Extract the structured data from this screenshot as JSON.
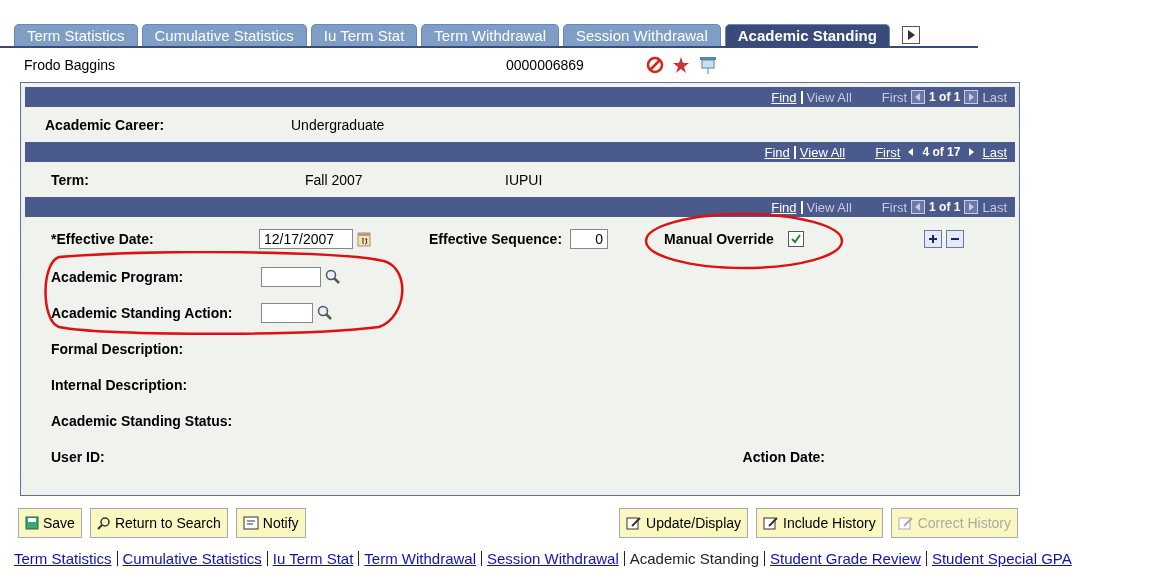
{
  "tabs": [
    {
      "label": "Term Statistics",
      "selected": false
    },
    {
      "label": "Cumulative Statistics",
      "selected": false
    },
    {
      "label": "Iu Term Stat",
      "selected": false
    },
    {
      "label": "Term Withdrawal",
      "selected": false
    },
    {
      "label": "Session Withdrawal",
      "selected": false
    },
    {
      "label": "Academic Standing",
      "selected": true
    }
  ],
  "header": {
    "name": "Frodo Baggins",
    "id": "0000006869"
  },
  "career_bar": {
    "find": {
      "label": "Find",
      "enabled": true
    },
    "view_all": {
      "label": "View All",
      "enabled": false
    },
    "first": {
      "label": "First",
      "enabled": false
    },
    "position": "1 of 1",
    "last": {
      "label": "Last",
      "enabled": false
    }
  },
  "career": {
    "label": "Academic Career:",
    "value": "Undergraduate"
  },
  "term_bar": {
    "find": {
      "label": "Find",
      "enabled": true
    },
    "view_all": {
      "label": "View All",
      "enabled": true
    },
    "first": {
      "label": "First",
      "enabled": true
    },
    "position": "4 of 17",
    "last": {
      "label": "Last",
      "enabled": true
    }
  },
  "term": {
    "label": "Term:",
    "value": "Fall 2007",
    "institution": "IUPUI"
  },
  "standing_bar": {
    "find": {
      "label": "Find",
      "enabled": true
    },
    "view_all": {
      "label": "View All",
      "enabled": false
    },
    "first": {
      "label": "First",
      "enabled": false
    },
    "position": "1 of 1",
    "last": {
      "label": "Last",
      "enabled": false
    }
  },
  "effective_date": {
    "label": "*Effective Date:",
    "value": "12/17/2007"
  },
  "effective_sequence": {
    "label": "Effective Sequence:",
    "value": "0"
  },
  "manual_override": {
    "label": "Manual Override",
    "checked": true
  },
  "academic_program": {
    "label": "Academic Program:"
  },
  "standing_action": {
    "label": "Academic Standing Action:"
  },
  "descriptions": [
    "Formal Description:",
    "Internal Description:",
    "Academic Standing Status:"
  ],
  "user_id": {
    "label": "User ID:"
  },
  "action_date": {
    "label": "Action Date:"
  },
  "buttons_left": [
    {
      "label": "Save",
      "kind": "save",
      "enabled": true
    },
    {
      "label": "Return to Search",
      "kind": "search",
      "enabled": true
    },
    {
      "label": "Notify",
      "kind": "notify",
      "enabled": true
    }
  ],
  "buttons_right": [
    {
      "label": "Update/Display",
      "kind": "edit",
      "enabled": true
    },
    {
      "label": "Include History",
      "kind": "edit",
      "enabled": true
    },
    {
      "label": "Correct History",
      "kind": "edit",
      "enabled": false
    }
  ],
  "bottom_links": [
    {
      "label": "Term Statistics",
      "current": false
    },
    {
      "label": "Cumulative Statistics",
      "current": false
    },
    {
      "label": "Iu Term Stat",
      "current": false
    },
    {
      "label": "Term Withdrawal",
      "current": false
    },
    {
      "label": "Session Withdrawal",
      "current": false
    },
    {
      "label": "Academic Standing",
      "current": true
    },
    {
      "label": "Student Grade Review",
      "current": false
    },
    {
      "label": "Student Special GPA",
      "current": false
    }
  ]
}
